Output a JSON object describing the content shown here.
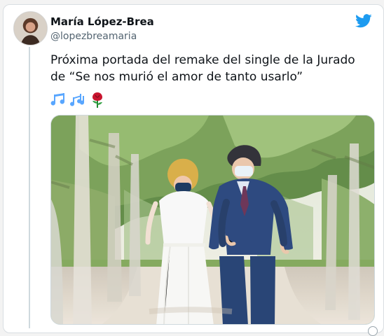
{
  "tweet": {
    "author": {
      "name": "María López-Brea",
      "handle": "@lopezbreamaria"
    },
    "text": "Próxima portada del remake del single de la Jurado\nde “Se nos murió el amor de tanto usarlo”",
    "emoji": [
      "musical-notes-emoji",
      "musical-notes-emoji",
      "rose-emoji"
    ],
    "brand_color": "#1d9bf0",
    "media": {
      "type": "photo",
      "alt": ""
    }
  }
}
